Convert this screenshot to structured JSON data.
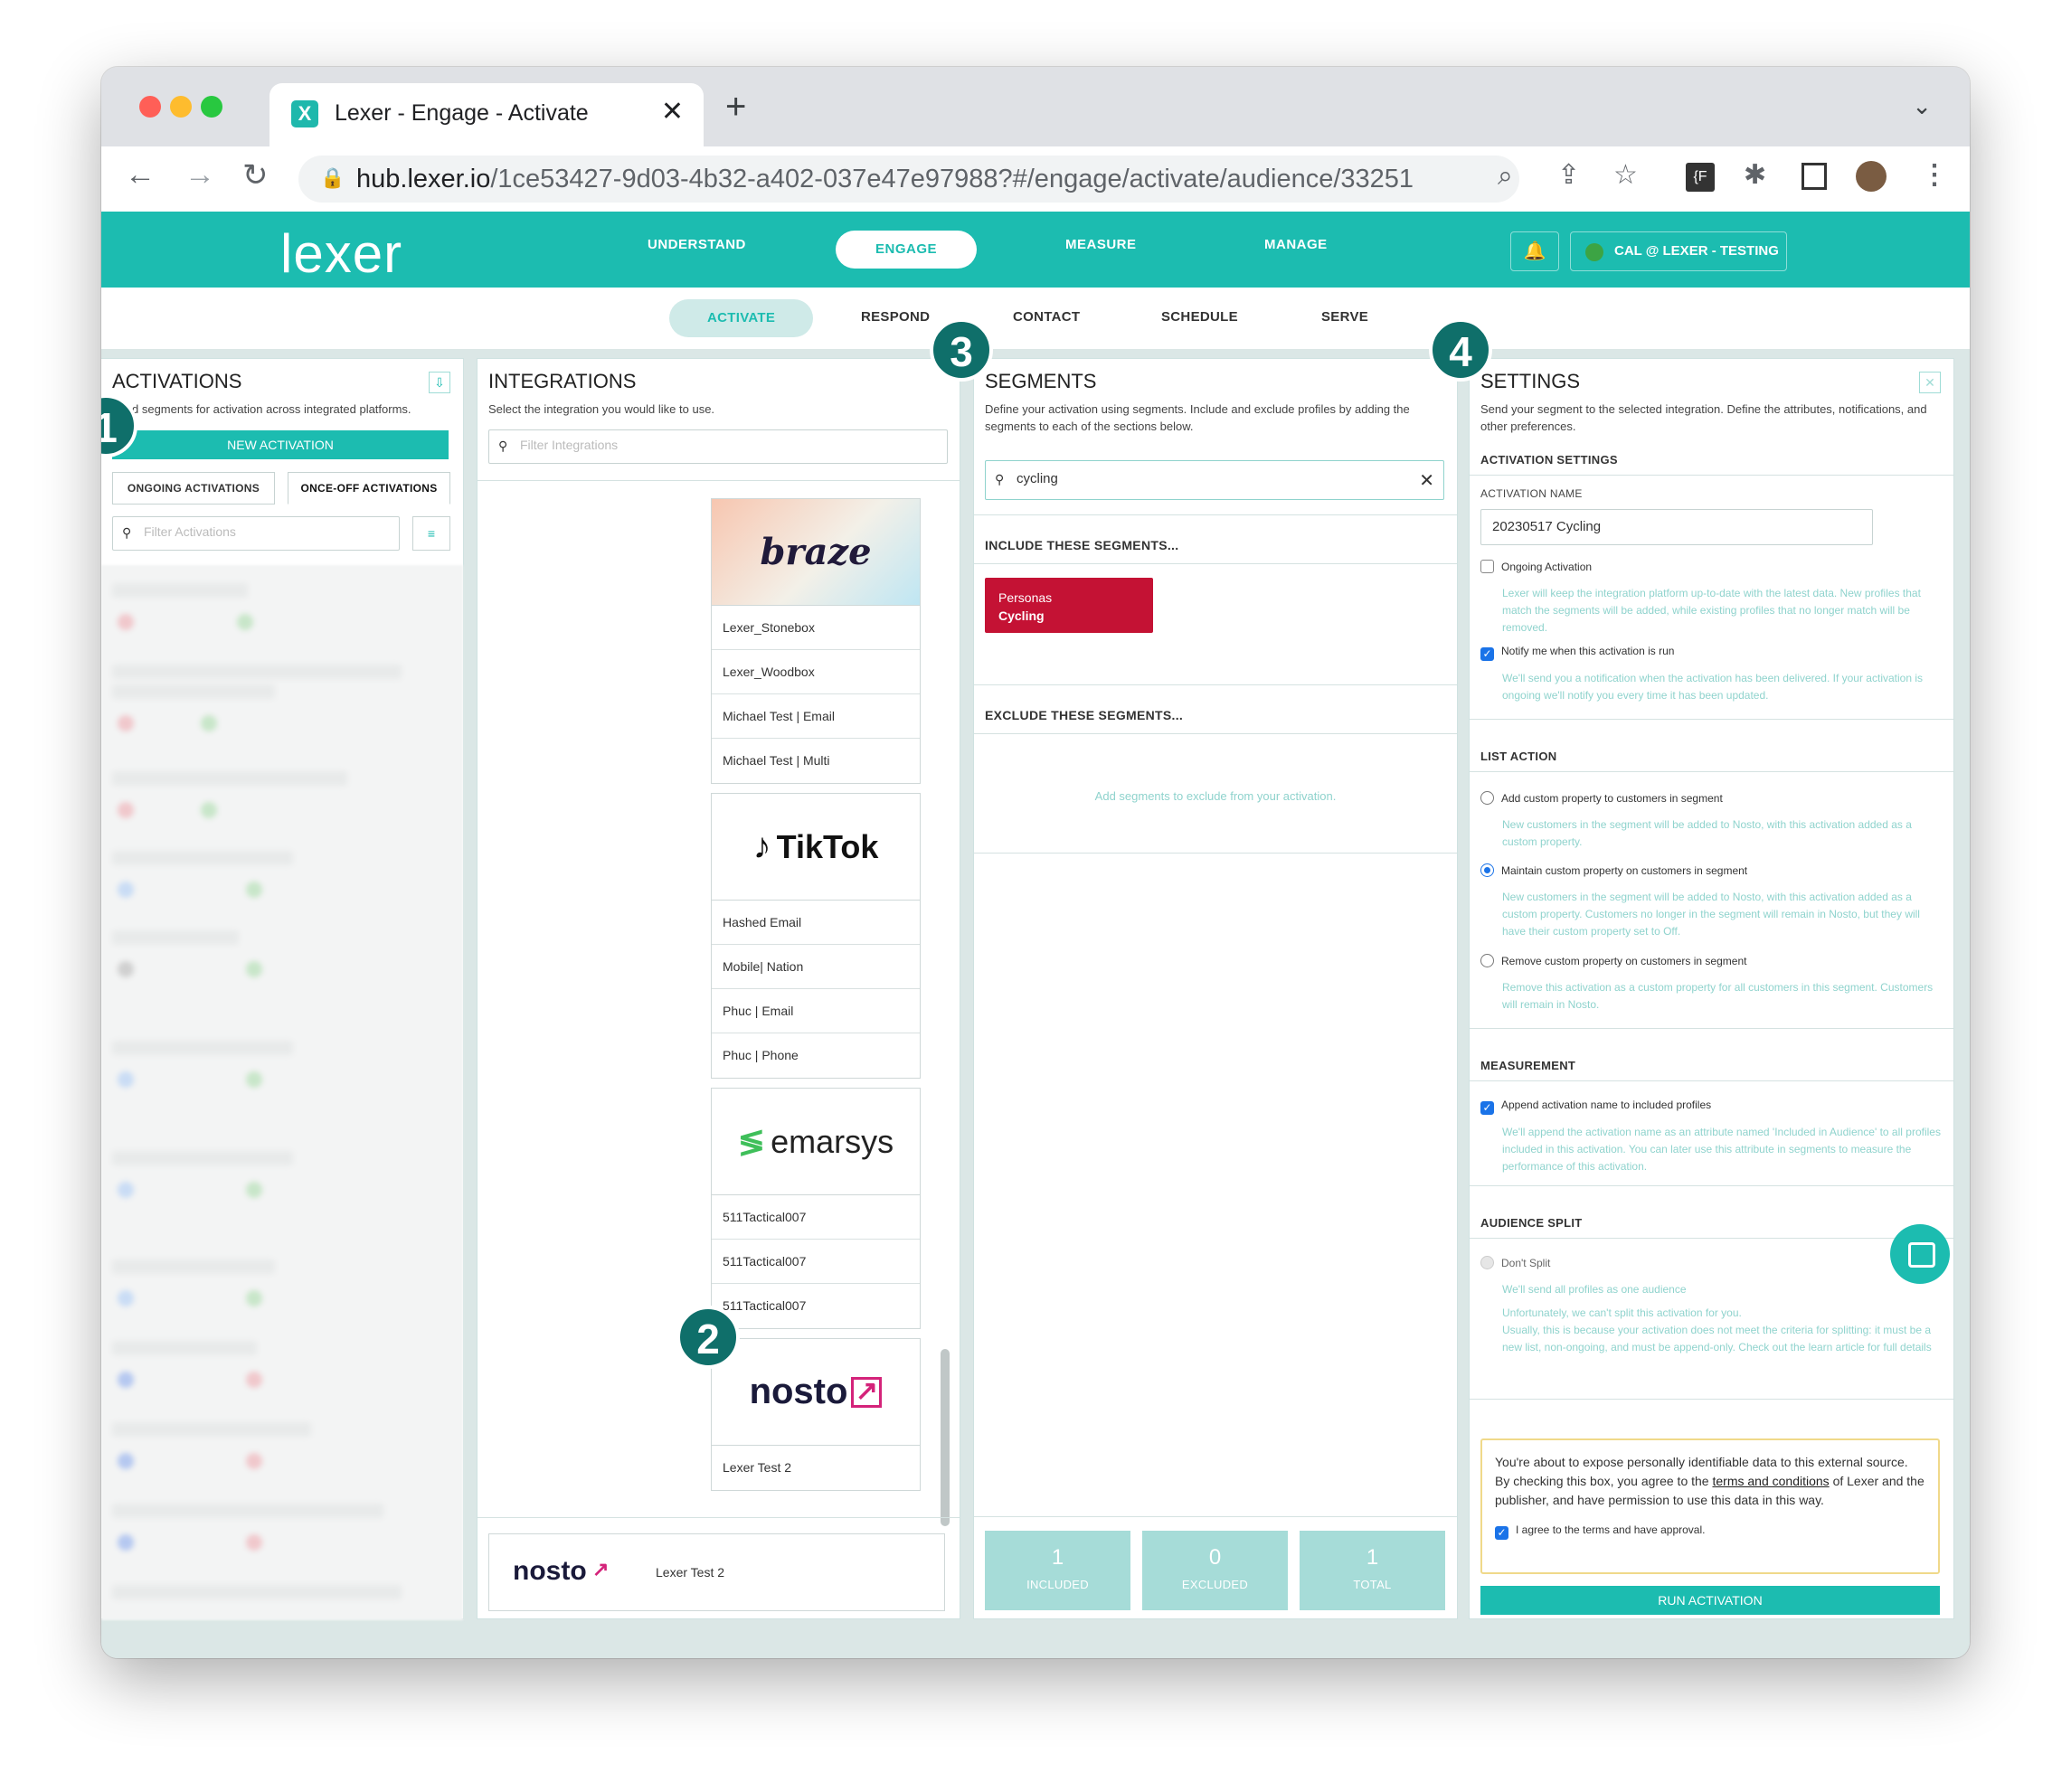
{
  "browser": {
    "tab_title": "Lexer - Engage - Activate",
    "tab_close": "✕",
    "new_tab": "+",
    "url_host": "hub.lexer.io",
    "url_path": "/1ce53427-9d03-4b32-a402-037e47e97988?#/engage/activate/audience/33251"
  },
  "app": {
    "logo": "lexer",
    "topnav": [
      "UNDERSTAND",
      "ENGAGE",
      "MEASURE",
      "MANAGE"
    ],
    "account": "CAL @ LEXER - TESTING",
    "subnav": [
      "ACTIVATE",
      "RESPOND",
      "CONTACT",
      "SCHEDULE",
      "SERVE"
    ]
  },
  "activations": {
    "title": "ACTIVATIONS",
    "desc": "d segments for activation across integrated platforms.",
    "new_button": "NEW ACTIVATION",
    "tabs": [
      "ONGOING ACTIVATIONS",
      "ONCE-OFF ACTIVATIONS"
    ],
    "filter_placeholder": "Filter Activations"
  },
  "integrations": {
    "title": "INTEGRATIONS",
    "desc": "Select the integration you would like to use.",
    "filter_placeholder": "Filter Integrations",
    "cards": [
      {
        "logo": "braze",
        "rows": [
          "Lexer_Stonebox",
          "Lexer_Woodbox",
          "Michael Test | Email",
          "Michael Test | Multi"
        ]
      },
      {
        "logo": "TikTok",
        "rows": [
          "Hashed Email",
          "Mobile| Nation",
          "Phuc | Email",
          "Phuc | Phone"
        ]
      },
      {
        "logo": "emarsys",
        "rows": [
          "511Tactical007",
          "511Tactical007",
          "511Tactical007"
        ]
      },
      {
        "logo": "nosto",
        "rows": [
          "Lexer Test 2"
        ]
      }
    ],
    "selected": {
      "logo": "nosto",
      "name": "Lexer Test 2"
    }
  },
  "segments": {
    "title": "SEGMENTS",
    "desc": "Define your activation using segments. Include and exclude profiles by adding the segments to each of the sections below.",
    "search_value": "cycling",
    "include_heading": "INCLUDE THESE SEGMENTS...",
    "chip_line1": "Personas",
    "chip_line2": "Cycling",
    "exclude_heading": "EXCLUDE THESE SEGMENTS...",
    "exclude_placeholder": "Add segments to exclude from your activation.",
    "stats": [
      {
        "value": "1",
        "label": "INCLUDED"
      },
      {
        "value": "0",
        "label": "EXCLUDED"
      },
      {
        "value": "1",
        "label": "TOTAL"
      }
    ]
  },
  "settings": {
    "title": "SETTINGS",
    "desc": "Send your segment to the selected integration. Define the attributes, notifications, and other preferences.",
    "activation_settings": "ACTIVATION SETTINGS",
    "name_label": "ACTIVATION NAME",
    "name_value": "20230517 Cycling",
    "ongoing_label": "Ongoing Activation",
    "ongoing_help": "Lexer will keep the integration platform up-to-date with the latest data. New profiles that match the segments will be added, while existing profiles that no longer match will be removed.",
    "notify_label": "Notify me when this activation is run",
    "notify_help": "We'll send you a notification when the activation has been delivered. If your activation is ongoing we'll notify you every time it has been updated.",
    "list_action": "LIST ACTION",
    "opt_add": "Add custom property to customers in segment",
    "opt_add_help": "New customers in the segment will be added to Nosto, with this activation added as a custom property.",
    "opt_maintain": "Maintain custom property on customers in segment",
    "opt_maintain_help": "New customers in the segment will be added to Nosto, with this activation added as a custom property. Customers no longer in the segment will remain in Nosto, but they will have their custom property set to Off.",
    "opt_remove": "Remove custom property on customers in segment",
    "opt_remove_help": "Remove this activation as a custom property for all customers in this segment. Customers will remain in Nosto.",
    "measurement": "MEASUREMENT",
    "append_label": "Append activation name to included profiles",
    "append_help": "We'll append the activation name as an attribute named 'Included in Audience' to all profiles included in this activation. You can later use this attribute in segments to measure the performance of this activation.",
    "audience_split": "AUDIENCE SPLIT",
    "dont_split": "Don't Split",
    "split_help1": "We'll send all profiles as one audience",
    "split_help2": "Unfortunately, we can't split this activation for you.",
    "split_help3": "Usually, this is because your activation does not meet the criteria for splitting: it must be a new list, non-ongoing, and must be append-only. Check out the learn article for full details",
    "agree_text1": "You're about to expose personally identifiable data to this external source. By checking this box, you agree to the",
    "agree_link": "terms and conditions",
    "agree_text2": "of Lexer and the publisher, and have permission to use this data in this way.",
    "agree_check": "I agree to the terms and have approval.",
    "run_button": "RUN ACTIVATION"
  },
  "badges": [
    "1",
    "2",
    "3",
    "4"
  ]
}
